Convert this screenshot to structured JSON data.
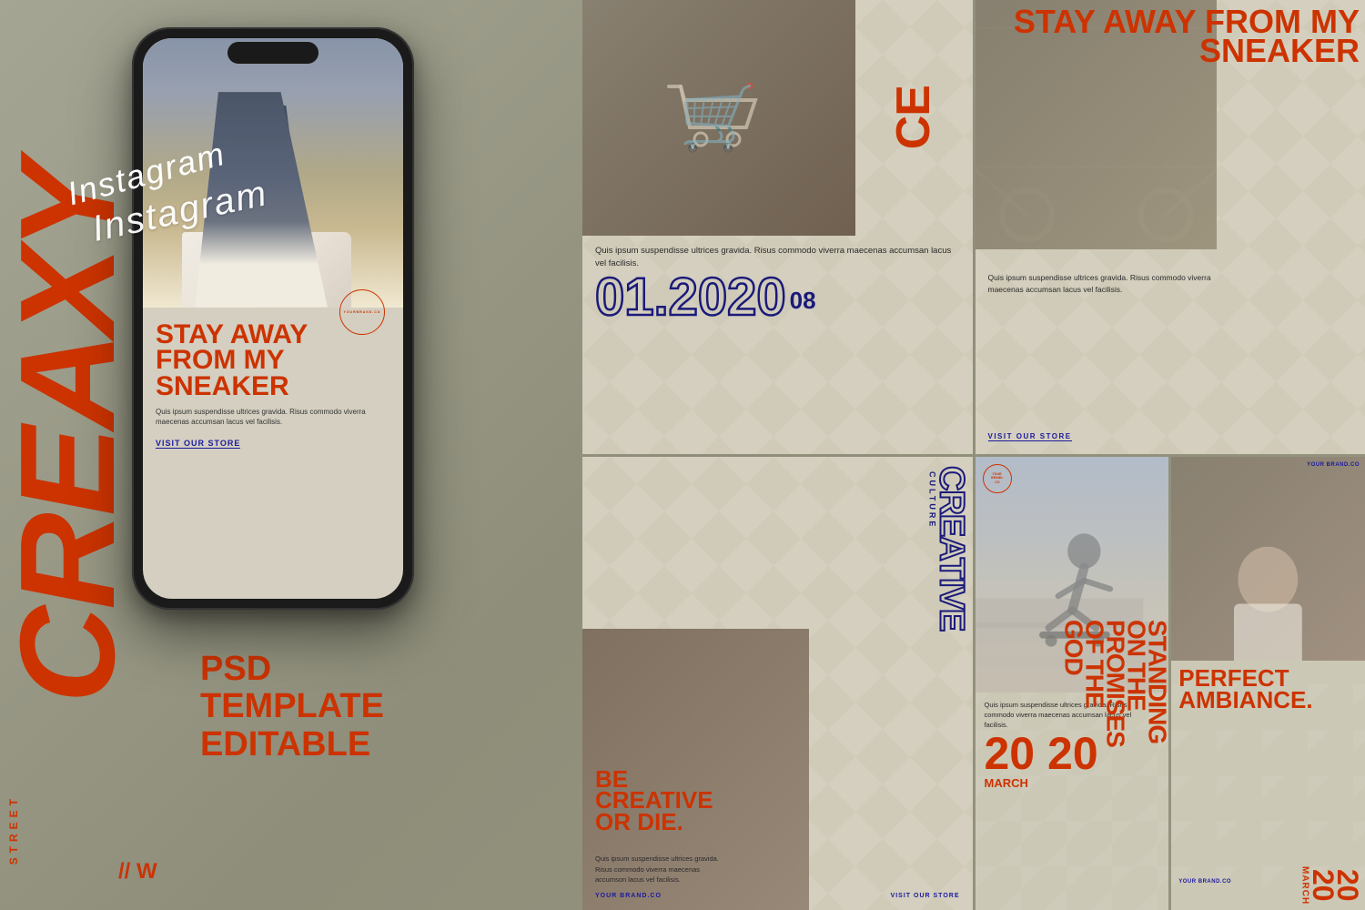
{
  "page": {
    "background_color": "#9e9e8a",
    "title": "CREAXY Instagram Template"
  },
  "left": {
    "brand_name": "CREAXY",
    "sub_label": "Instagram",
    "street_label": "STREET",
    "psd_lines": [
      "PSD",
      "TEMPLATE",
      "EDITABLE"
    ]
  },
  "phone": {
    "headline": "STAY AWAY FROM MY SNEAKER",
    "body_text": "Quis ipsum suspendisse ultrices gravida. Risus commodo viverra maecenas accumsan lacus vel facilisis.",
    "cta": "VISIT OUR STORE",
    "brand": "YOURBRAND.CO"
  },
  "card1": {
    "vertical_text": "CE",
    "body_text": "Quis ipsum suspendisse ultrices gravida. Risus commodo viverra maecenas accumsan lacus vel facilisis.",
    "date_main": "01.2020",
    "date_small": "08"
  },
  "card2": {
    "headline": "STAY AWAY FROM MY SNEAKER",
    "body_text": "Quis ipsum suspendisse ultrices gravida. Risus commodo viverra maecenas accumsan lacus vel facilisis.",
    "cta": "VISIT OUR STORE"
  },
  "card3": {
    "creative_title": "CREATIVE",
    "creative_sub": "CULTURE",
    "headline_line1": "BE",
    "headline_line2": "CREATIVE",
    "headline_line3": "OR DIE.",
    "body_text": "Quis ipsum suspendisse ultrices gravida. Risus commodo viverra maecenas accumson lacus vel facilisis.",
    "cta_left": "YOUR BRAND.CO",
    "cta_right": "VISIT OUR STORE"
  },
  "card4_skater": {
    "brand": "YOURBRAND.CO",
    "vertical_text": "STANDING ON THE PROMISES OF THE GOD",
    "body_text": "Quis ipsum suspendisse ultrices gravida. R sus commodo viverra maecenas accumsan lacus vel facilisis.",
    "date": "20 20",
    "month": "MARCH"
  },
  "card4_ambiance": {
    "brand": "YOUR BRAND.CO",
    "headline_line1": "PERFECT",
    "headline_line2": "AMBIANCE.",
    "date": "20 20",
    "month": "MARCH",
    "brand2": "YOUR BRAND.CO"
  }
}
